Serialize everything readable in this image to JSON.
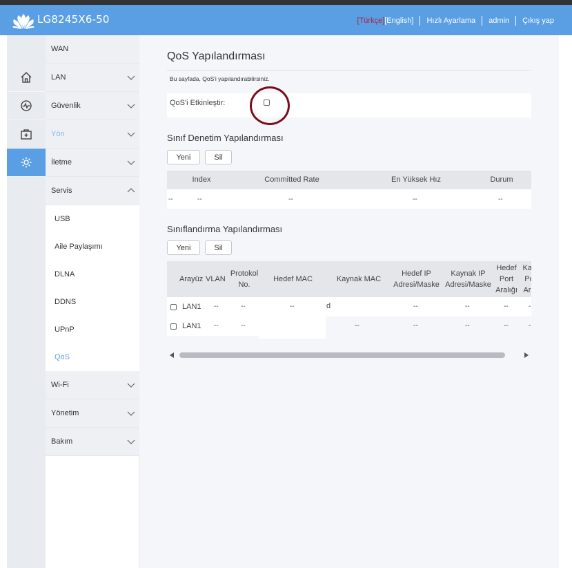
{
  "header": {
    "model": "LG8245X6-50",
    "lang_tr": "[Türkçe]",
    "lang_en": "[English]",
    "quick_setup": "Hızlı Ayarlama",
    "user": "admin",
    "logout": "Çıkış yap",
    "logo_icon": "huawei-logo"
  },
  "sidebar": {
    "icons": [
      "home-icon",
      "status-icon",
      "add-icon",
      "settings-icon"
    ],
    "items": [
      {
        "label": "WAN"
      },
      {
        "label": "LAN"
      },
      {
        "label": "Güvenlik"
      },
      {
        "label": "Yön"
      },
      {
        "label": "İletme"
      },
      {
        "label": "Servis"
      },
      {
        "label": "Wi-Fi"
      },
      {
        "label": "Yönetim"
      },
      {
        "label": "Bakım"
      }
    ],
    "sub_items": [
      {
        "label": "USB"
      },
      {
        "label": "Aile Paylaşımı"
      },
      {
        "label": "DLNA"
      },
      {
        "label": "DDNS"
      },
      {
        "label": "UPnP"
      },
      {
        "label": "QoS"
      }
    ]
  },
  "main": {
    "title": "QoS Yapılandırması",
    "description": "Bu sayfada, QoS'i yapılandırabilirsiniz.",
    "enable_label": "QoS'i Etkinleştir:",
    "enable_checked": false,
    "class_audit": {
      "title": "Sınıf Denetim Yapılandırması",
      "new_button": "Yeni",
      "delete_button": "Sil",
      "headers": [
        "Index",
        "Committed Rate",
        "En Yüksek Hız",
        "Durum"
      ],
      "row": [
        "--",
        "--",
        "--",
        "--",
        "--"
      ]
    },
    "classification": {
      "title": "Sınıflandırma Yapılandırması",
      "new_button": "Yeni",
      "delete_button": "Sil",
      "headers": {
        "interface": "Arayüz",
        "vlan": "VLAN",
        "protocol_1": "Protokol",
        "protocol_2": "No.",
        "dest_mac": "Hedef MAC",
        "src_mac": "Kaynak MAC",
        "dest_ip_1": "Hedef IP",
        "dest_ip_2": "Adresi/Maske",
        "src_ip_1": "Kaynak IP",
        "src_ip_2": "Adresi/Maske",
        "dest_port_1": "Hedef",
        "dest_port_2": "Port",
        "dest_port_3": "Aralığı",
        "src_port_1": "Kay",
        "src_port_2": "Po",
        "src_port_3": "Ara"
      },
      "rows": [
        {
          "interface": "LAN1",
          "vlan": "--",
          "protocol": "--",
          "dest_mac": "--",
          "src_mac": "d",
          "dest_ip": "--",
          "src_ip": "--",
          "dest_port": "--",
          "src_port": "-"
        },
        {
          "interface": "LAN1",
          "vlan": "--",
          "protocol": "--",
          "dest_mac": "",
          "src_mac": "--",
          "dest_ip": "--",
          "src_ip": "--",
          "dest_port": "--",
          "src_port": "-"
        }
      ]
    }
  },
  "colors": {
    "header_bg": "#5a9ee4",
    "accent": "#5a9ee4",
    "annotation_circle": "#7a0c1c"
  }
}
